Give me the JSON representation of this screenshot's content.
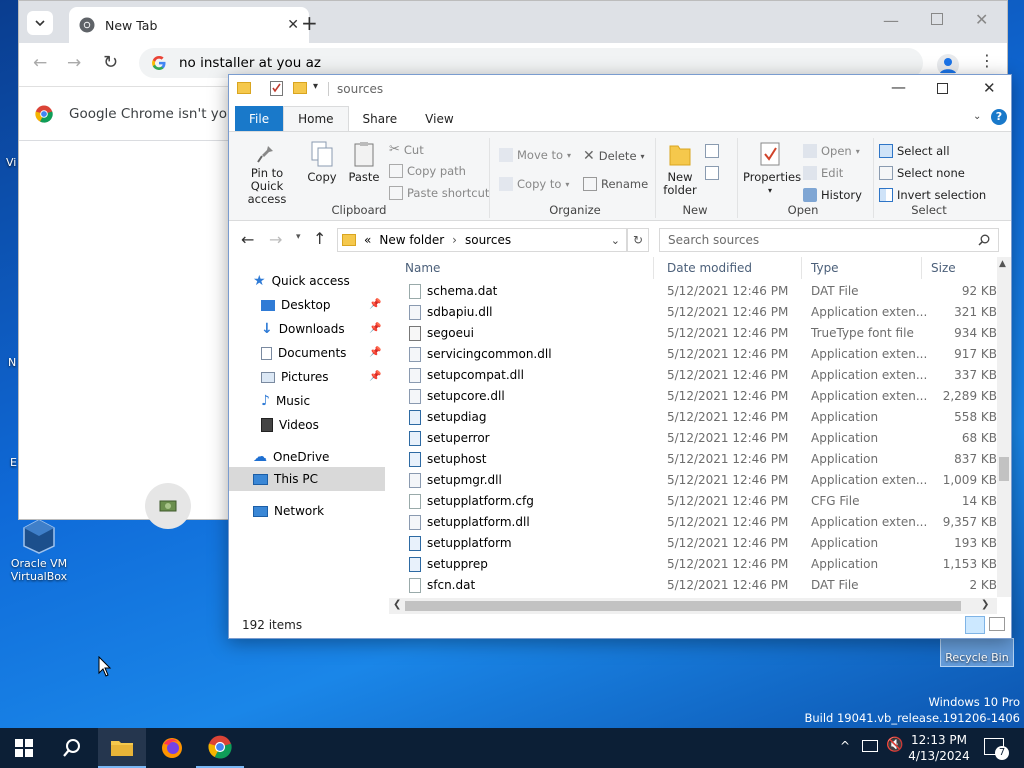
{
  "desktop": {
    "edge_labels": [
      "Vi",
      "N",
      "E"
    ],
    "icons": {
      "virtualbox": "Oracle VM VirtualBox",
      "recycle_bin": "Recycle Bin"
    },
    "watermark": {
      "line1": "Windows 10 Pro",
      "line2": "Build 19041.vb_release.191206-1406"
    }
  },
  "chrome": {
    "tab_title": "New Tab",
    "omnibox_value": "no installer at you az",
    "infobar_text": "Google Chrome isn't your d"
  },
  "explorer": {
    "title": "sources",
    "ribbon_tabs": [
      "File",
      "Home",
      "Share",
      "View"
    ],
    "ribbon": {
      "clipboard": {
        "pin": "Pin to Quick access",
        "copy": "Copy",
        "paste": "Paste",
        "cut": "Cut",
        "copy_path": "Copy path",
        "paste_shortcut": "Paste shortcut",
        "label": "Clipboard"
      },
      "organize": {
        "move_to": "Move to",
        "copy_to": "Copy to",
        "delete": "Delete",
        "rename": "Rename",
        "label": "Organize"
      },
      "new": {
        "new_folder": "New folder",
        "label": "New"
      },
      "open": {
        "properties": "Properties",
        "open": "Open",
        "edit": "Edit",
        "history": "History",
        "label": "Open"
      },
      "select": {
        "select_all": "Select all",
        "select_none": "Select none",
        "invert": "Invert selection",
        "label": "Select"
      }
    },
    "address": {
      "prefix": "«",
      "crumb1": "New folder",
      "crumb2": "sources"
    },
    "search_placeholder": "Search sources",
    "nav": {
      "quick_access": "Quick access",
      "desktop": "Desktop",
      "downloads": "Downloads",
      "documents": "Documents",
      "pictures": "Pictures",
      "music": "Music",
      "videos": "Videos",
      "onedrive": "OneDrive",
      "this_pc": "This PC",
      "network": "Network"
    },
    "columns": {
      "name": "Name",
      "date": "Date modified",
      "type": "Type",
      "size": "Size"
    },
    "files": [
      {
        "name": "schema.dat",
        "date": "5/12/2021 12:46 PM",
        "type": "DAT File",
        "size": "92 KB",
        "icon": "file"
      },
      {
        "name": "sdbapiu.dll",
        "date": "5/12/2021 12:46 PM",
        "type": "Application exten...",
        "size": "321 KB",
        "icon": "dll"
      },
      {
        "name": "segoeui",
        "date": "5/12/2021 12:46 PM",
        "type": "TrueType font file",
        "size": "934 KB",
        "icon": "font"
      },
      {
        "name": "servicingcommon.dll",
        "date": "5/12/2021 12:46 PM",
        "type": "Application exten...",
        "size": "917 KB",
        "icon": "dll"
      },
      {
        "name": "setupcompat.dll",
        "date": "5/12/2021 12:46 PM",
        "type": "Application exten...",
        "size": "337 KB",
        "icon": "dll"
      },
      {
        "name": "setupcore.dll",
        "date": "5/12/2021 12:46 PM",
        "type": "Application exten...",
        "size": "2,289 KB",
        "icon": "dll"
      },
      {
        "name": "setupdiag",
        "date": "5/12/2021 12:46 PM",
        "type": "Application",
        "size": "558 KB",
        "icon": "app"
      },
      {
        "name": "setuperror",
        "date": "5/12/2021 12:46 PM",
        "type": "Application",
        "size": "68 KB",
        "icon": "app"
      },
      {
        "name": "setuphost",
        "date": "5/12/2021 12:46 PM",
        "type": "Application",
        "size": "837 KB",
        "icon": "app"
      },
      {
        "name": "setupmgr.dll",
        "date": "5/12/2021 12:46 PM",
        "type": "Application exten...",
        "size": "1,009 KB",
        "icon": "dll"
      },
      {
        "name": "setupplatform.cfg",
        "date": "5/12/2021 12:46 PM",
        "type": "CFG File",
        "size": "14 KB",
        "icon": "file"
      },
      {
        "name": "setupplatform.dll",
        "date": "5/12/2021 12:46 PM",
        "type": "Application exten...",
        "size": "9,357 KB",
        "icon": "dll"
      },
      {
        "name": "setupplatform",
        "date": "5/12/2021 12:46 PM",
        "type": "Application",
        "size": "193 KB",
        "icon": "app"
      },
      {
        "name": "setupprep",
        "date": "5/12/2021 12:46 PM",
        "type": "Application",
        "size": "1,153 KB",
        "icon": "app"
      },
      {
        "name": "sfcn.dat",
        "date": "5/12/2021 12:46 PM",
        "type": "DAT File",
        "size": "2 KB",
        "icon": "file"
      }
    ],
    "status": "192 items"
  },
  "taskbar": {
    "time": "12:13 PM",
    "date": "4/13/2024",
    "notification_count": "7"
  },
  "colors": {
    "accent": "#1979ca",
    "taskbar": "#0c1f36",
    "selection": "#cce8ff"
  }
}
